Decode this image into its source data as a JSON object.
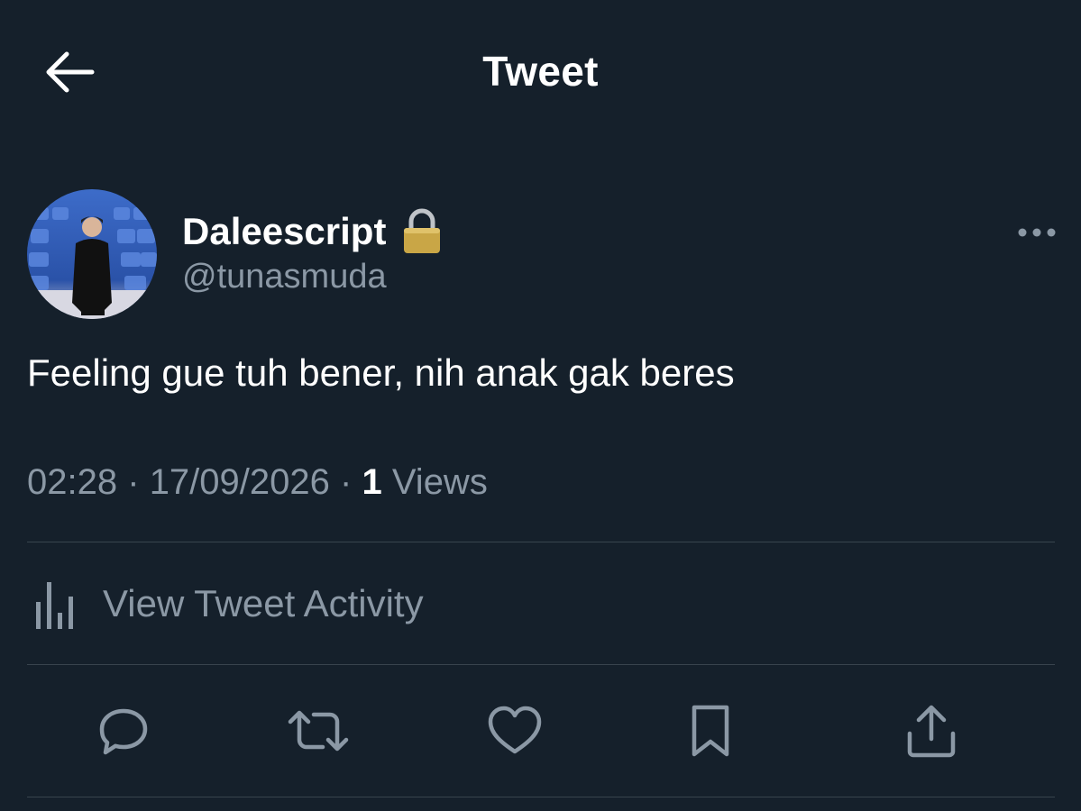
{
  "header": {
    "title": "Tweet",
    "back_icon": "arrow-left-icon"
  },
  "tweet": {
    "author": {
      "display_name": "Daleescript",
      "handle": "@tunasmuda",
      "protected_icon": "lock-icon",
      "avatar": "avatar"
    },
    "text": "Feeling gue tuh bener, nih anak gak beres",
    "time": "02:28",
    "separator": "·",
    "date": "17/09/2026",
    "views_count": "1",
    "views_label": "Views",
    "more_icon": "more-horizontal-icon"
  },
  "activity": {
    "label": "View Tweet Activity",
    "icon": "bar-chart-icon"
  },
  "actions": [
    {
      "name": "reply",
      "icon": "reply-icon"
    },
    {
      "name": "retweet",
      "icon": "retweet-icon"
    },
    {
      "name": "like",
      "icon": "heart-icon"
    },
    {
      "name": "bookmark",
      "icon": "bookmark-icon"
    },
    {
      "name": "share",
      "icon": "share-icon"
    }
  ],
  "colors": {
    "background": "#15202b",
    "primary_text": "#ffffff",
    "secondary_text": "#8b98a5",
    "divider": "#38444d",
    "lock_gold": "#c9a646"
  }
}
